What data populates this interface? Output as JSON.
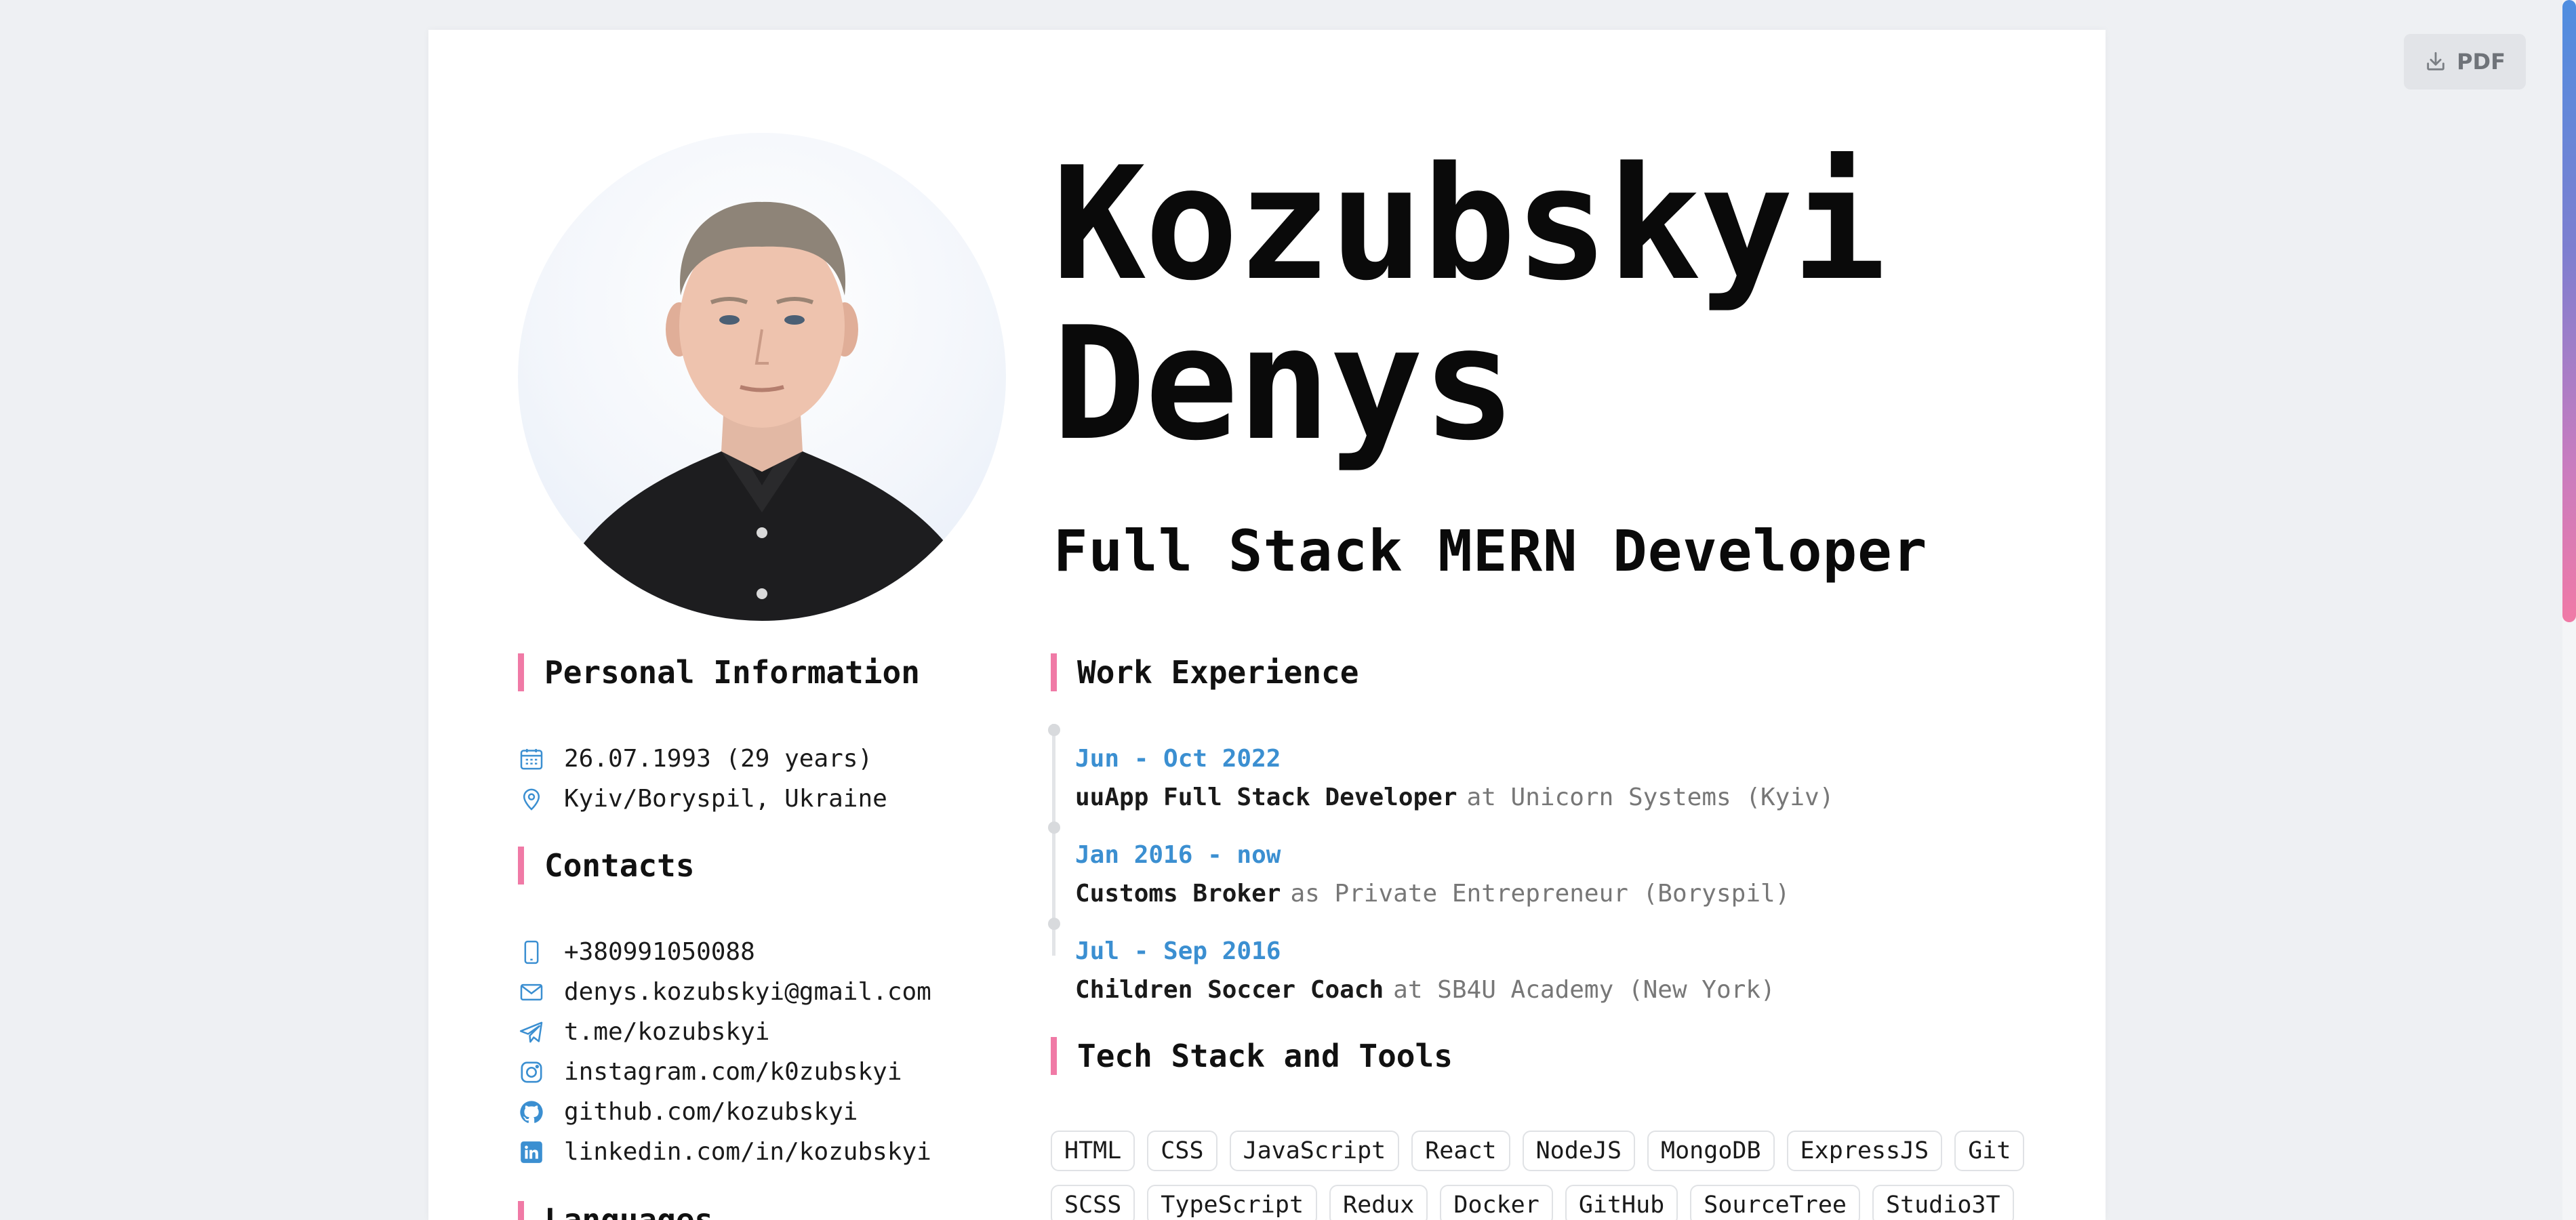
{
  "toolbar": {
    "pdf_label": "PDF",
    "pdf_icon": "download-icon"
  },
  "header": {
    "name_line1": "Kozubskyi",
    "name_line2": "Denys",
    "role": "Full Stack MERN Developer"
  },
  "personal": {
    "title": "Personal Information",
    "items": [
      {
        "icon": "calendar-icon",
        "text": "26.07.1993 (29 years)"
      },
      {
        "icon": "map-pin-icon",
        "text": "Kyiv/Boryspil, Ukraine"
      }
    ]
  },
  "contacts": {
    "title": "Contacts",
    "items": [
      {
        "icon": "phone-icon",
        "text": "+380991050088"
      },
      {
        "icon": "mail-icon",
        "text": "denys.kozubskyi@gmail.com"
      },
      {
        "icon": "telegram-icon",
        "text": "t.me/kozubskyi"
      },
      {
        "icon": "instagram-icon",
        "text": "instagram.com/k0zubskyi"
      },
      {
        "icon": "github-icon",
        "text": "github.com/kozubskyi"
      },
      {
        "icon": "linkedin-icon",
        "text": "linkedin.com/in/kozubskyi"
      }
    ]
  },
  "languages": {
    "title": "Languages"
  },
  "work": {
    "title": "Work Experience",
    "items": [
      {
        "date": "Jun - Oct 2022",
        "position": "uuApp Full Stack Developer",
        "company": "at Unicorn Systems (Kyiv)"
      },
      {
        "date": "Jan 2016 - now",
        "position": "Customs Broker",
        "company": "as Private Entrepreneur (Boryspil)"
      },
      {
        "date": "Jul - Sep 2016",
        "position": "Children Soccer Coach",
        "company": "at SB4U Academy (New York)"
      }
    ]
  },
  "tech": {
    "title": "Tech Stack and Tools",
    "tags": [
      "HTML",
      "CSS",
      "JavaScript",
      "React",
      "NodeJS",
      "MongoDB",
      "ExpressJS",
      "Git",
      "SCSS",
      "TypeScript",
      "Redux",
      "Docker",
      "GitHub",
      "SourceTree",
      "Studio3T"
    ]
  },
  "colors": {
    "accent": "#f07aa6",
    "link_blue": "#3b8fd1",
    "icon_blue": "#3b8fd1"
  }
}
